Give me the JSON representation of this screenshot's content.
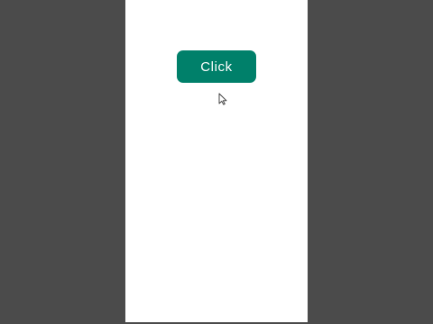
{
  "page": {
    "background_color": "#ffffff",
    "outer_background_color": "#4b4b4b"
  },
  "button": {
    "label": "Click",
    "color": "#00806a",
    "text_color": "#ffffff"
  },
  "cursor": {
    "icon": "arrow-pointer-icon"
  }
}
